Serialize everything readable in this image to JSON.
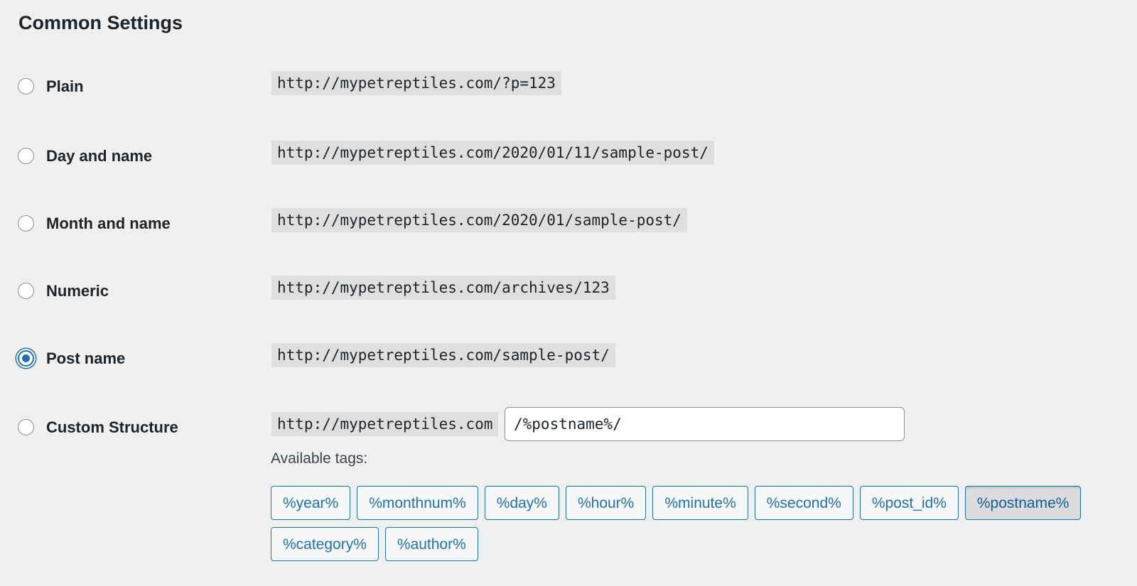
{
  "section": {
    "title": "Common Settings"
  },
  "options": [
    {
      "label": "Plain",
      "example": "http://mypetreptiles.com/?p=123",
      "checked": false
    },
    {
      "label": "Day and name",
      "example": "http://mypetreptiles.com/2020/01/11/sample-post/",
      "checked": false
    },
    {
      "label": "Month and name",
      "example": "http://mypetreptiles.com/2020/01/sample-post/",
      "checked": false
    },
    {
      "label": "Numeric",
      "example": "http://mypetreptiles.com/archives/123",
      "checked": false
    },
    {
      "label": "Post name",
      "example": "http://mypetreptiles.com/sample-post/",
      "checked": true
    },
    {
      "label": "Custom Structure",
      "example": "http://mypetreptiles.com",
      "checked": false
    }
  ],
  "custom": {
    "value": "/%postname%/",
    "available_tags_label": "Available tags:"
  },
  "tags": [
    {
      "label": "%year%",
      "active": false
    },
    {
      "label": "%monthnum%",
      "active": false
    },
    {
      "label": "%day%",
      "active": false
    },
    {
      "label": "%hour%",
      "active": false
    },
    {
      "label": "%minute%",
      "active": false
    },
    {
      "label": "%second%",
      "active": false
    },
    {
      "label": "%post_id%",
      "active": false
    },
    {
      "label": "%postname%",
      "active": true
    },
    {
      "label": "%category%",
      "active": false
    },
    {
      "label": "%author%",
      "active": false
    }
  ],
  "colors": {
    "accent": "#2271b1",
    "background": "#f0f0f1",
    "text": "#1d2327"
  }
}
